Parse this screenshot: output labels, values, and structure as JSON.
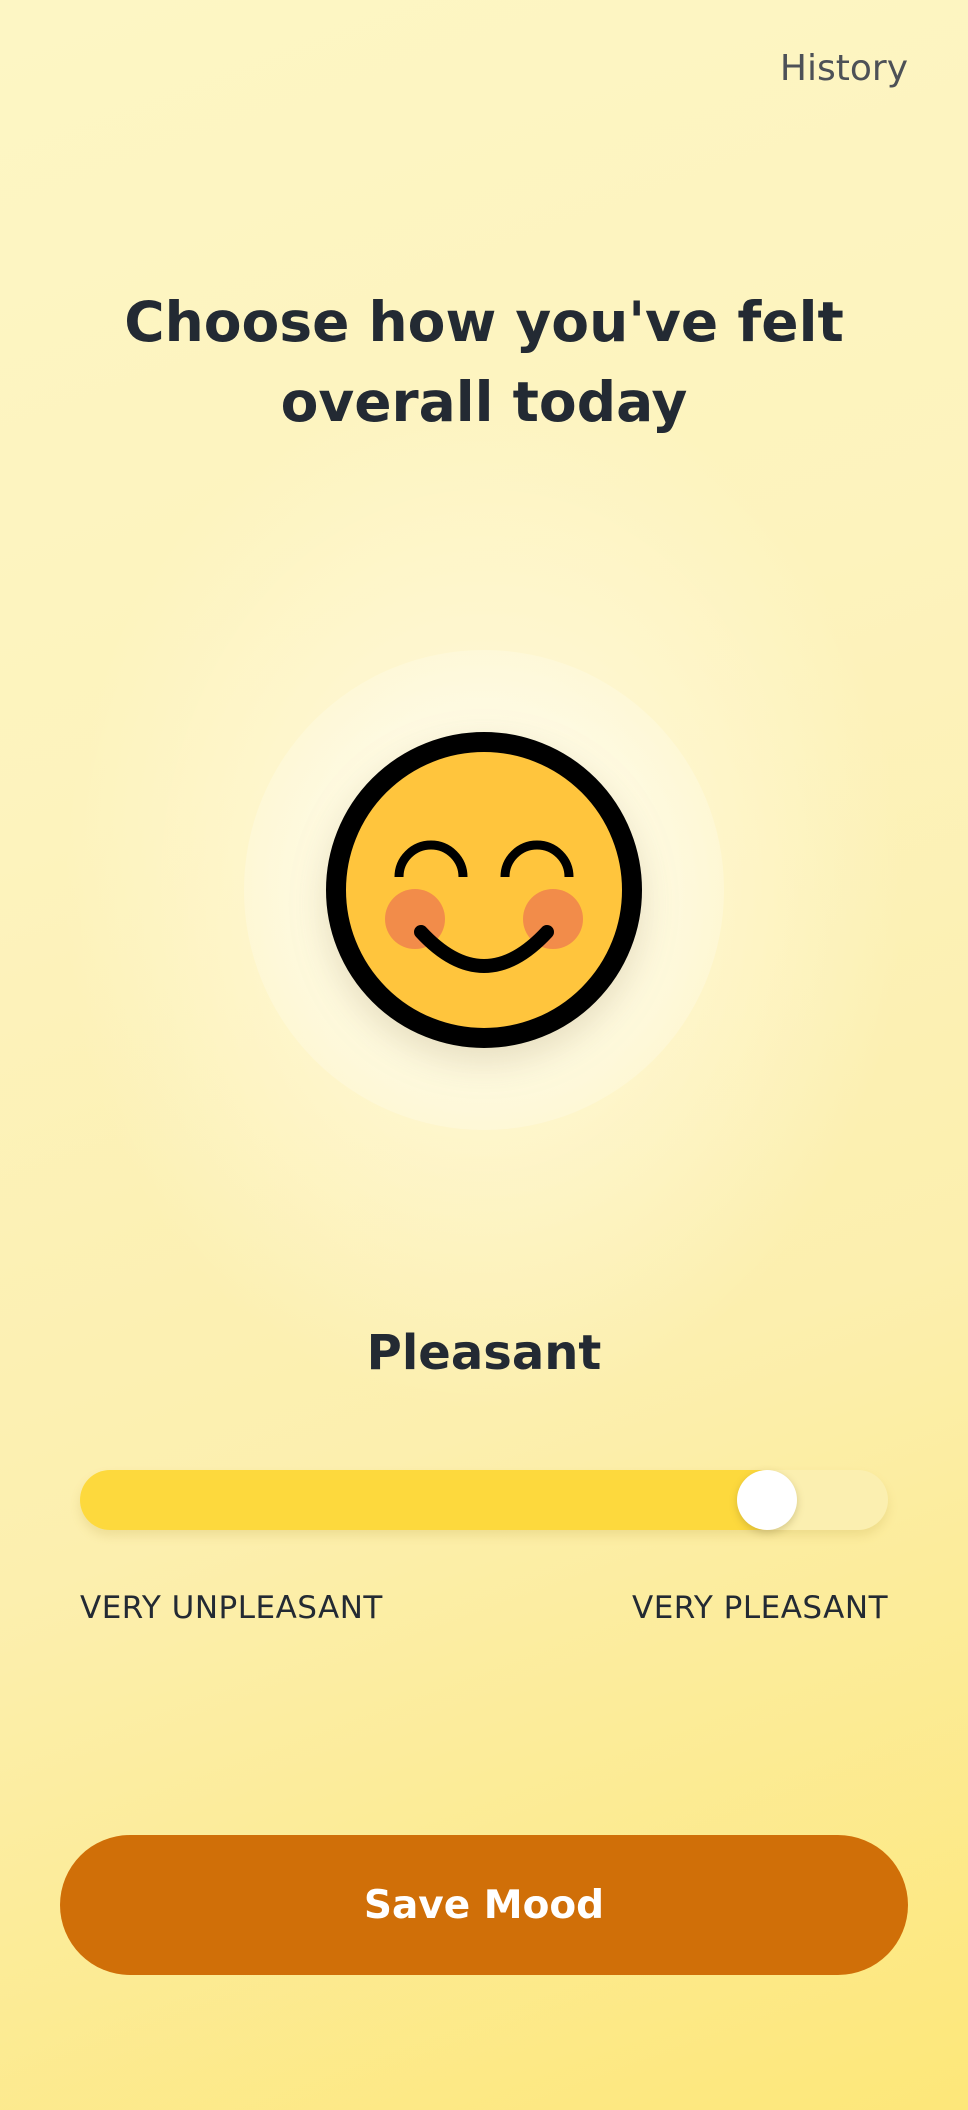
{
  "header": {
    "history_label": "History"
  },
  "main": {
    "title": "Choose how you've felt overall today",
    "emoji_icon": "smiling-face-with-blush-icon",
    "mood_label": "Pleasant",
    "slider": {
      "value_fraction": 0.85,
      "min_label": "VERY UNPLEASANT",
      "max_label": "VERY PLEASANT"
    },
    "save_label": "Save Mood"
  },
  "colors": {
    "background_top": "#fdf6c4",
    "background_bottom": "#fde779",
    "emoji_face": "#ffc53d",
    "emoji_blush": "#f28c4a",
    "slider_fill": "#fdd93d",
    "slider_track": "#fbefb0",
    "save_button": "#d06f08",
    "text_primary": "#232a33"
  }
}
